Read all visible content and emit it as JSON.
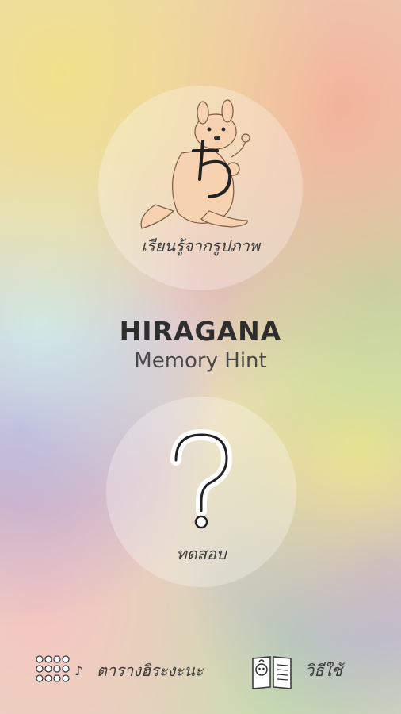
{
  "app": {
    "title": "HIRAGANA",
    "subtitle": "Memory Hint"
  },
  "cards": {
    "learn": {
      "label": "เรียนรู้จากรูปภาพ",
      "icon": "kangaroo-hiragana-illustration"
    },
    "quiz": {
      "label": "ทดสอบ",
      "icon": "question-mark-icon"
    }
  },
  "bottom_nav": {
    "chart": {
      "label": "ตารางฮิระงะนะ",
      "icon": "hiragana-chart-icon"
    },
    "howto": {
      "label": "วิธีใช้",
      "icon": "guide-book-icon"
    }
  }
}
